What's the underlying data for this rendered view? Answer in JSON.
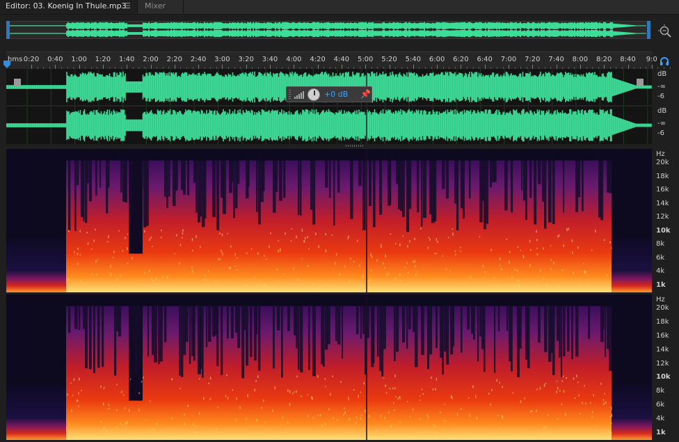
{
  "tabs": {
    "editor_label": "Editor: 03. Koenig In Thule.mp3",
    "editor_menu_icon": "hamburger-menu-icon",
    "mixer_label": "Mixer"
  },
  "ruler": {
    "unit_label": "hms",
    "labels": [
      "0:20",
      "0:40",
      "1:00",
      "1:20",
      "1:40",
      "2:00",
      "2:20",
      "2:40",
      "3:00",
      "3:20",
      "3:40",
      "4:00",
      "4:20",
      "4:40",
      "5:00",
      "5:20",
      "5:40",
      "6:00",
      "6:20",
      "6:40",
      "7:00",
      "7:20",
      "7:40",
      "8:00",
      "8:20",
      "8:40",
      "9:0"
    ]
  },
  "hud": {
    "value": "+0 dB",
    "meter_icon": "level-meter-icon",
    "knob_icon": "volume-knob-icon",
    "pin_icon": "pin-icon"
  },
  "amplitude_scale": {
    "top": {
      "unit": "dB",
      "inf": "-∞",
      "minus6": "-6"
    },
    "bottom": {
      "unit": "dB",
      "inf": "-∞",
      "minus6": "-6"
    }
  },
  "frequency_scale": {
    "unit": "Hz",
    "labels": [
      "20k",
      "18k",
      "16k",
      "14k",
      "12k",
      "10k",
      "8k",
      "6k",
      "4k",
      "1k"
    ]
  },
  "colors": {
    "waveform": "#3ddc97",
    "accent": "#2f77c0",
    "spectral_low": "#ffe27a",
    "spectral_mid": "#e0320f",
    "spectral_high": "#5a1a70"
  }
}
